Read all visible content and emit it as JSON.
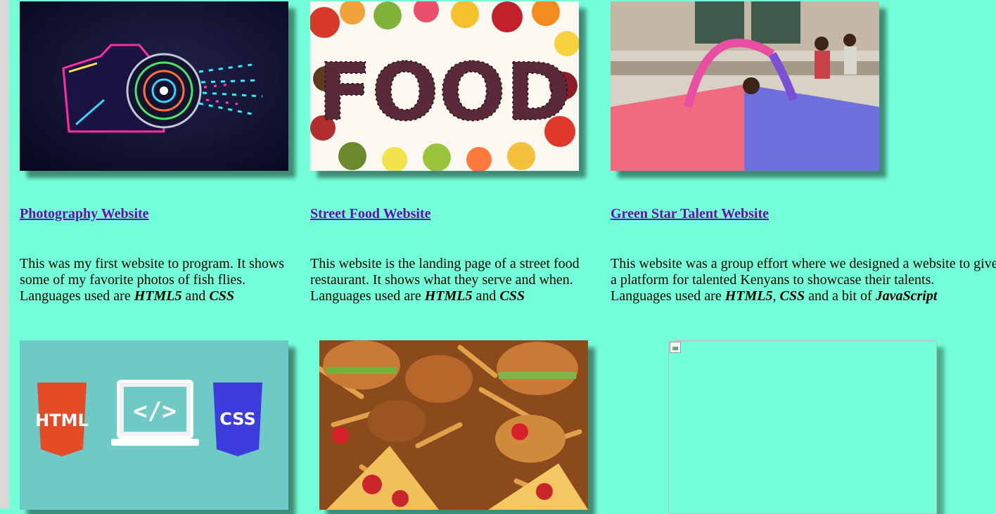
{
  "projects": [
    {
      "title": "Photography Website",
      "desc_line1": "This was my first website to program. It shows",
      "desc_line2": "some of my favorite photos of fish flies.",
      "lang_prefix": "Languages used are ",
      "lang1": "HTML5",
      "sep1": " and ",
      "lang2": "CSS"
    },
    {
      "title": "Street Food Website",
      "desc_line1": "This website is the landing page of a street food",
      "desc_line2": "restaurant. It shows what they serve and when.",
      "lang_prefix": "Languages used are ",
      "lang1": "HTML5",
      "sep1": " and ",
      "lang2": "CSS"
    },
    {
      "title": "Green Star Talent Website",
      "desc_line1": "This website was a group effort where we designed a website to give",
      "desc_line2": "a platform for talented Kenyans to showcase their talents.",
      "lang_prefix": "Languages used are ",
      "lang1": "HTML5",
      "sep1": ", ",
      "lang2": "CSS",
      "sep2": " and a bit of ",
      "lang3": "JavaScript"
    }
  ],
  "images": {
    "camera_icon": "camera-illustration",
    "food_word": "FOOD",
    "html_badge": "HTML",
    "css_badge": "CSS",
    "code_symbol": "</>"
  },
  "colors": {
    "background": "#73ffd7",
    "link": "#6a0dad"
  }
}
